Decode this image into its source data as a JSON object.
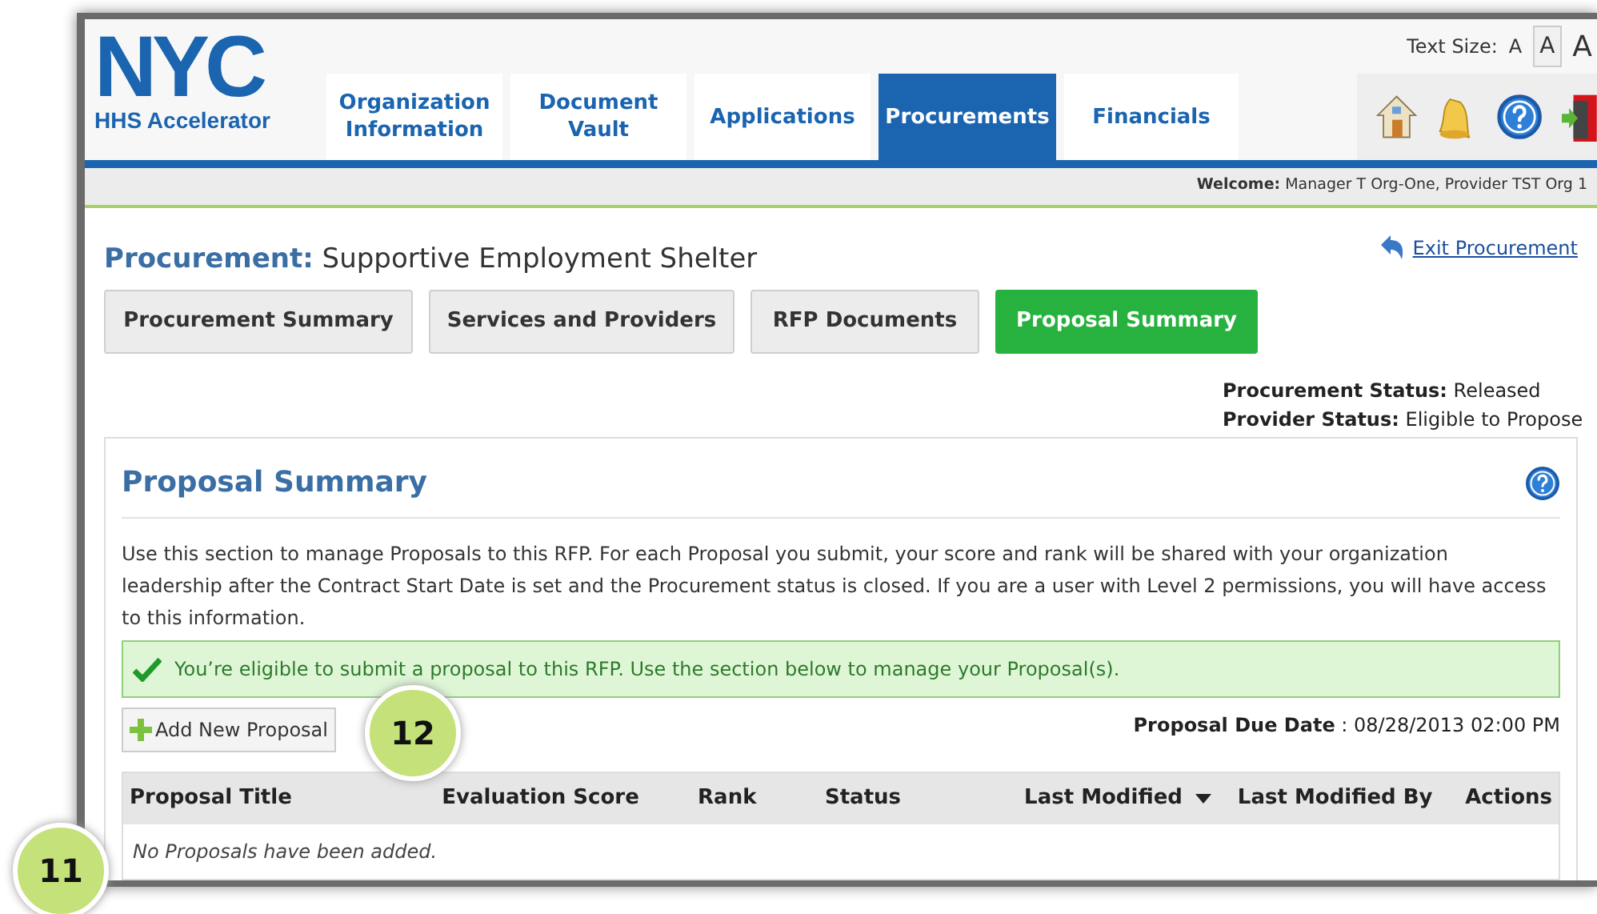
{
  "logo": {
    "title": "NYC",
    "subtitle": "HHS Accelerator"
  },
  "text_size": {
    "label": "Text Size:",
    "options": [
      {
        "label": "A",
        "selected": false
      },
      {
        "label": "A",
        "selected": true
      },
      {
        "label": "A",
        "selected": false
      }
    ]
  },
  "nav_tabs": [
    {
      "label": "Organization Information",
      "selected": false
    },
    {
      "label": "Document Vault",
      "selected": false
    },
    {
      "label": "Applications",
      "selected": false
    },
    {
      "label": "Procurements",
      "selected": true
    },
    {
      "label": "Financials",
      "selected": false
    }
  ],
  "welcome": {
    "label": "Welcome:",
    "value": "Manager T Org-One,  Provider TST Org 1"
  },
  "procurement": {
    "label": "Procurement:",
    "name": "Supportive Employment Shelter",
    "exit_link": "Exit Procurement"
  },
  "sub_tabs": [
    {
      "label": "Procurement Summary",
      "selected": false
    },
    {
      "label": "Services and Providers",
      "selected": false
    },
    {
      "label": "RFP Documents",
      "selected": false
    },
    {
      "label": "Proposal Summary",
      "selected": true
    }
  ],
  "statuses": [
    {
      "label": "Procurement Status:",
      "value": "Released"
    },
    {
      "label": "Provider Status:",
      "value": "Eligible to Propose"
    }
  ],
  "panel": {
    "title": "Proposal Summary",
    "description": "Use this section to manage Proposals to this RFP. For each Proposal you submit, your score and rank will be shared with your organization leadership after the Contract Start Date is set and the Procurement status is closed. If you are a user with Level 2 permissions, you will have access to this information.",
    "alert": "You’re eligible to submit a proposal to this RFP. Use the section below to manage your Proposal(s).",
    "add_button": "Add New Proposal",
    "due_date": {
      "label": "Proposal Due Date",
      "value": ": 08/28/2013 02:00 PM"
    },
    "table": {
      "columns": [
        {
          "label": "Proposal Title",
          "sorted": false
        },
        {
          "label": "Evaluation Score",
          "sorted": false
        },
        {
          "label": "Rank",
          "sorted": false
        },
        {
          "label": "Status",
          "sorted": false
        },
        {
          "label": "Last Modified",
          "sorted": true
        },
        {
          "label": "Last Modified By",
          "sorted": false
        },
        {
          "label": "Actions",
          "sorted": false
        }
      ],
      "empty_message": "No Proposals have been added."
    }
  },
  "callouts": [
    "11",
    "12"
  ]
}
